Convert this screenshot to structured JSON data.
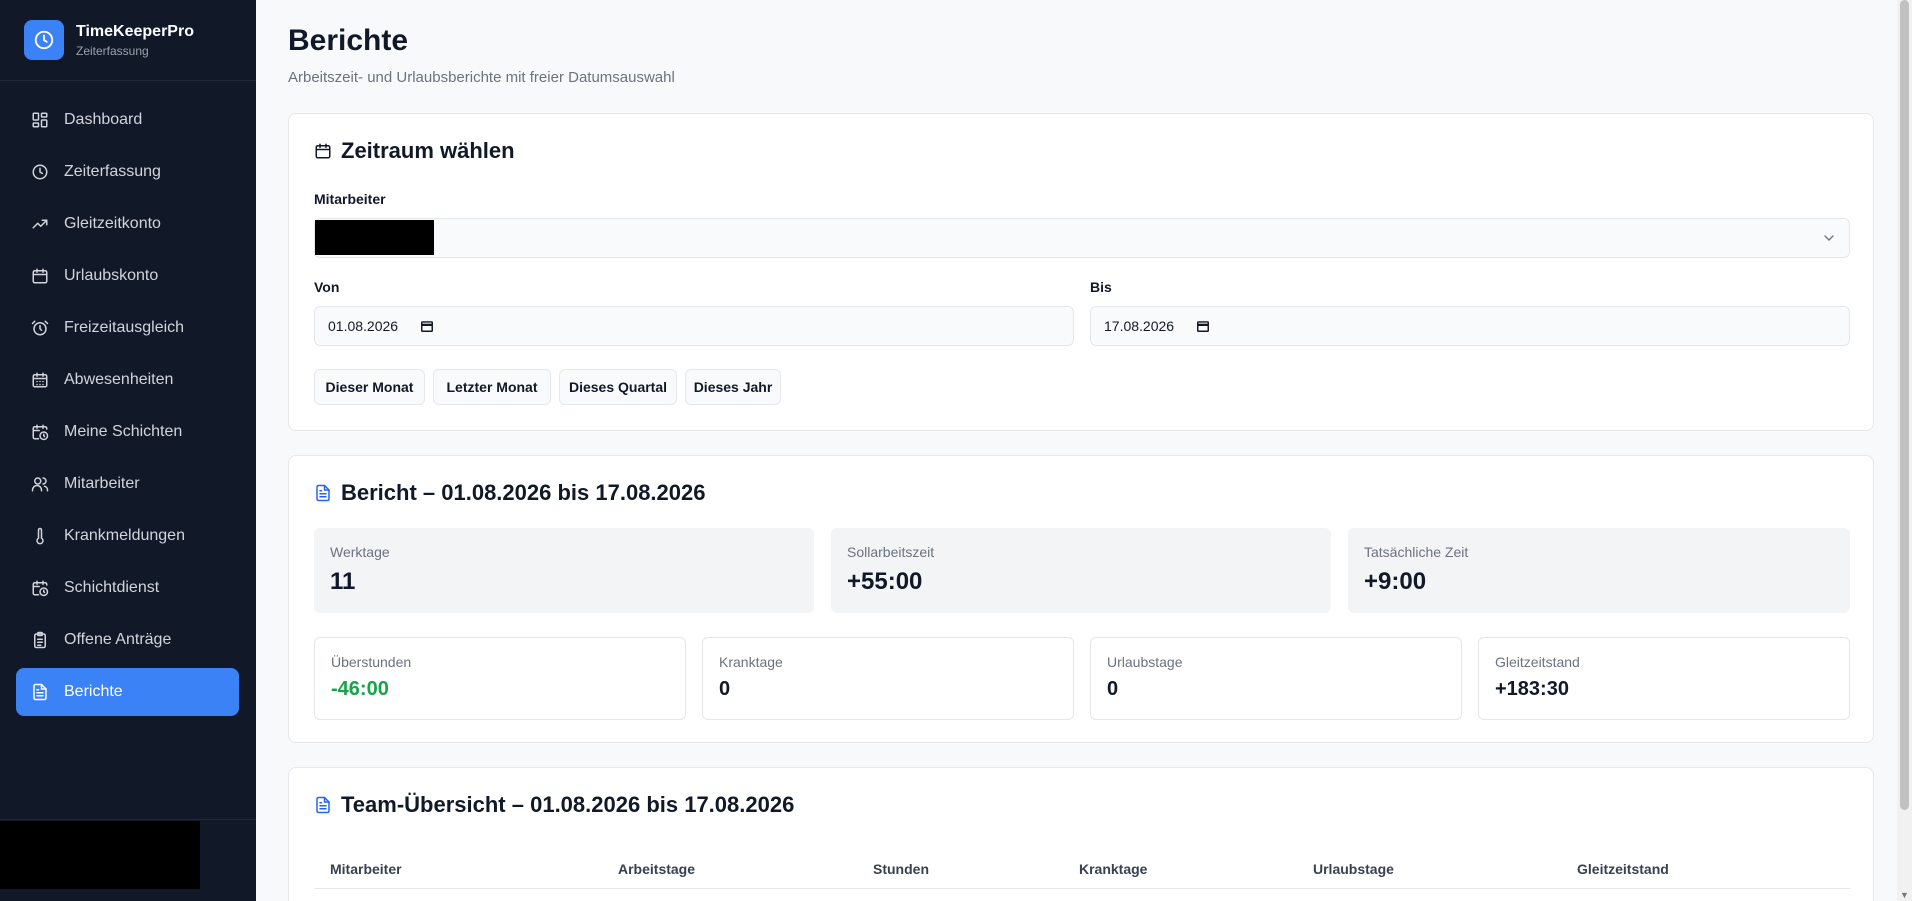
{
  "app": {
    "title": "TimeKeeperPro",
    "subtitle": "Zeiterfassung",
    "accent_color": "#3b82f6",
    "sidebar_bg": "#111827"
  },
  "sidebar": {
    "items": [
      {
        "label": "Dashboard",
        "icon": "dashboard-icon",
        "active": false
      },
      {
        "label": "Zeiterfassung",
        "icon": "clock-icon",
        "active": false
      },
      {
        "label": "Gleitzeitkonto",
        "icon": "trending-up-icon",
        "active": false
      },
      {
        "label": "Urlaubskonto",
        "icon": "calendar-icon",
        "active": false
      },
      {
        "label": "Freizeitausgleich",
        "icon": "alarm-clock-icon",
        "active": false
      },
      {
        "label": "Abwesenheiten",
        "icon": "calendar-days-icon",
        "active": false
      },
      {
        "label": "Meine Schichten",
        "icon": "calendar-clock-icon",
        "active": false
      },
      {
        "label": "Mitarbeiter",
        "icon": "users-icon",
        "active": false
      },
      {
        "label": "Krankmeldungen",
        "icon": "thermometer-icon",
        "active": false
      },
      {
        "label": "Schichtdienst",
        "icon": "calendar-clock-icon",
        "active": false
      },
      {
        "label": "Offene Anträge",
        "icon": "clipboard-list-icon",
        "active": false
      },
      {
        "label": "Berichte",
        "icon": "file-text-icon",
        "active": true
      }
    ]
  },
  "header": {
    "title": "Berichte",
    "subtitle": "Arbeitszeit- und Urlaubsberichte mit freier Datumsauswahl"
  },
  "period": {
    "title": "Zeitraum wählen",
    "employee_label": "Mitarbeiter",
    "from_label": "Von",
    "from_value": "01.08.2026",
    "to_label": "Bis",
    "to_value": "17.08.2026",
    "quick_buttons": [
      "Dieser Monat",
      "Letzter Monat",
      "Dieses Quartal",
      "Dieses Jahr"
    ]
  },
  "report": {
    "title": "Bericht – 01.08.2026 bis 17.08.2026",
    "top_stats": [
      {
        "label": "Werktage",
        "value": "11"
      },
      {
        "label": "Sollarbeitszeit",
        "value": "+55:00"
      },
      {
        "label": "Tatsächliche Zeit",
        "value": "+9:00"
      }
    ],
    "bottom_stats": [
      {
        "label": "Überstunden",
        "value": "-46:00",
        "color": "#16a34a"
      },
      {
        "label": "Kranktage",
        "value": "0"
      },
      {
        "label": "Urlaubstage",
        "value": "0"
      },
      {
        "label": "Gleitzeitstand",
        "value": "+183:30"
      }
    ]
  },
  "team": {
    "title": "Team-Übersicht – 01.08.2026 bis 17.08.2026",
    "columns": [
      "Mitarbeiter",
      "Arbeitstage",
      "Stunden",
      "Kranktage",
      "Urlaubstage",
      "Gleitzeitstand"
    ]
  }
}
